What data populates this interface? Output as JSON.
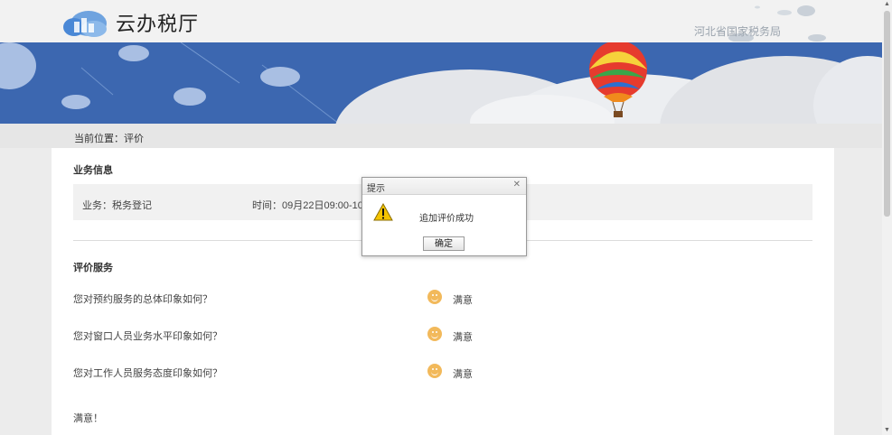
{
  "header": {
    "site_title": "云办税厅",
    "agency_name": "河北省国家税务局",
    "logo_icon": "cloud-tax-logo-icon"
  },
  "breadcrumb": "当前位置：评价",
  "business_info": {
    "section_title": "业务信息",
    "business": "业务：税务登记",
    "time": "时间：09月22日09:00-10:00"
  },
  "evaluation": {
    "section_title": "评价服务",
    "questions": [
      {
        "question": "您对预约服务的总体印象如何？",
        "rating": "满意",
        "icon": "smile-face-icon"
      },
      {
        "question": "您对窗口人员业务水平印象如何？",
        "rating": "满意",
        "icon": "smile-face-icon"
      },
      {
        "question": "您对工作人员服务态度印象如何？",
        "rating": "满意",
        "icon": "smile-face-icon"
      }
    ],
    "comment": "满意！"
  },
  "dialog": {
    "title": "提示",
    "close_icon": "close-icon",
    "message": "追加评价成功",
    "ok_label": "确定",
    "icon": "warning-icon"
  },
  "colors": {
    "banner_blue": "#3c67b0",
    "header_bg": "#f2f2f2",
    "smile_orange": "#f2b95b"
  }
}
